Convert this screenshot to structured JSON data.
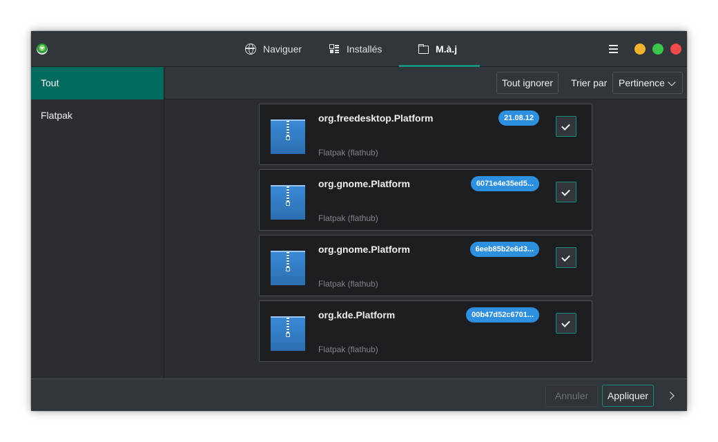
{
  "header": {
    "tabs": [
      {
        "label": "Naviguer",
        "icon": "globe-icon"
      },
      {
        "label": "Installés",
        "icon": "list-icon"
      },
      {
        "label": "M.à.j",
        "icon": "folder-update-icon",
        "active": true
      }
    ],
    "menu_icon": "hamburger-menu-icon",
    "window_buttons": {
      "minimize": "#f1b22d",
      "maximize": "#39c64a",
      "close": "#ee4b4b"
    }
  },
  "sidebar": {
    "items": [
      {
        "label": "Tout",
        "active": true
      },
      {
        "label": "Flatpak"
      }
    ]
  },
  "toolbar": {
    "ignore_all_label": "Tout ignorer",
    "sort_label": "Trier par",
    "sort_value": "Pertinence"
  },
  "updates": [
    {
      "name": "org.freedesktop.Platform",
      "version": "21.08.12",
      "source": "Flatpak (flathub)",
      "checked": true
    },
    {
      "name": "org.gnome.Platform",
      "version": "6071e4e35ed5...",
      "source": "Flatpak (flathub)",
      "checked": true
    },
    {
      "name": "org.gnome.Platform",
      "version": "6eeb85b2e6d3...",
      "source": "Flatpak (flathub)",
      "checked": true
    },
    {
      "name": "org.kde.Platform",
      "version": "00b47d52c6701...",
      "source": "Flatpak (flathub)",
      "checked": true
    }
  ],
  "footer": {
    "cancel_label": "Annuler",
    "apply_label": "Appliquer"
  },
  "colors": {
    "accent": "#1a8c7e",
    "selected": "#006a5e",
    "badge": "#2d8fe0"
  }
}
